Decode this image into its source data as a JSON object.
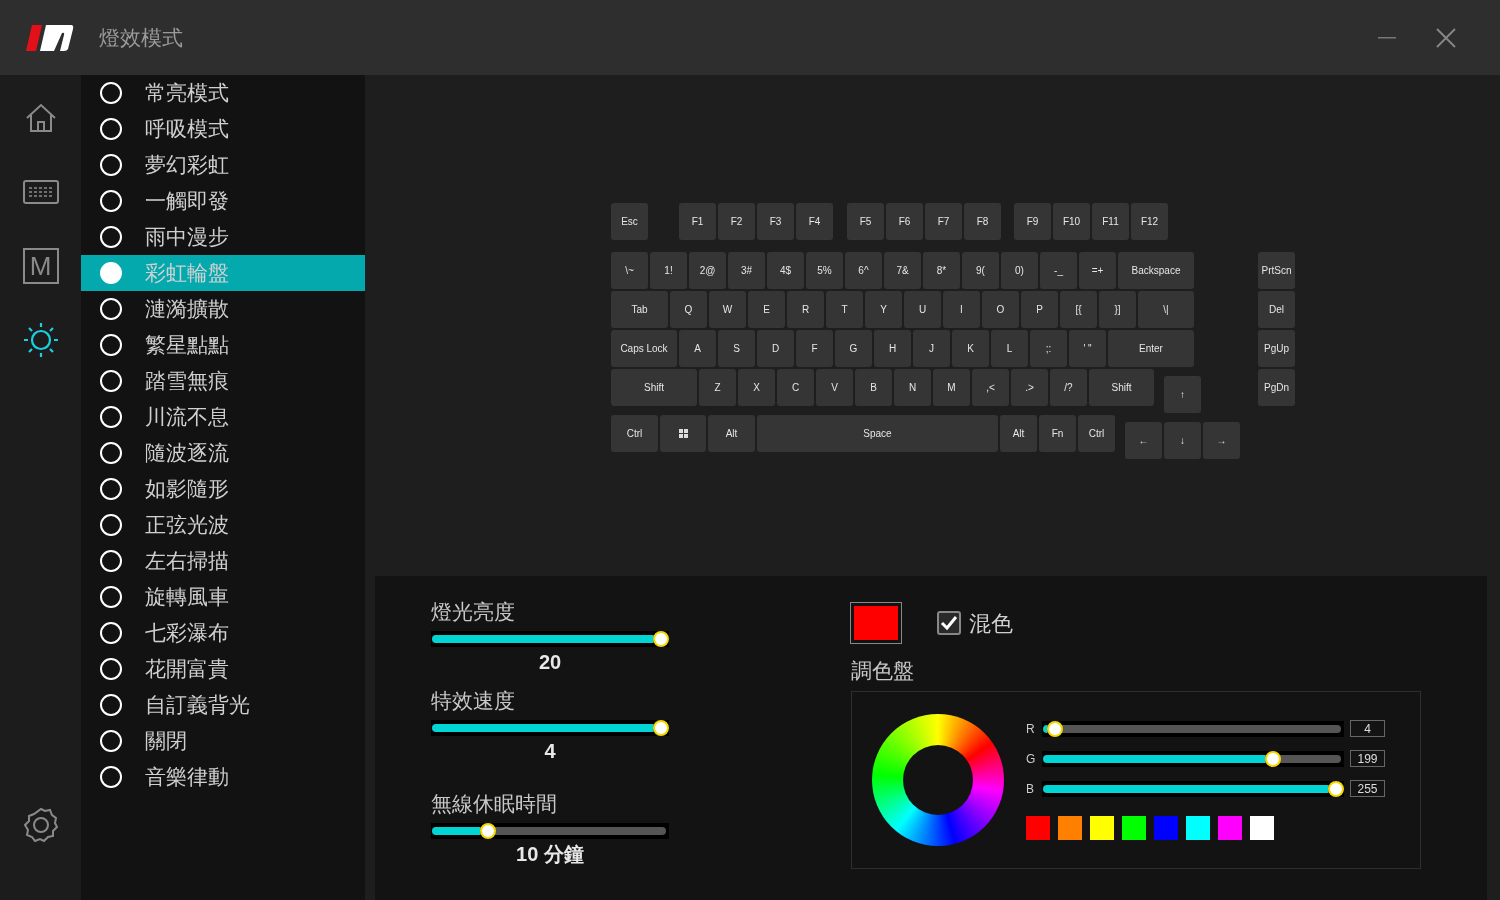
{
  "window": {
    "title": "燈效模式"
  },
  "nav": [
    {
      "kind": "home",
      "selected": false
    },
    {
      "kind": "keyboard",
      "selected": false
    },
    {
      "kind": "macro",
      "label": "M",
      "selected": false
    },
    {
      "kind": "lighting",
      "selected": true
    }
  ],
  "modes": [
    {
      "label": "常亮模式",
      "selected": false
    },
    {
      "label": "呼吸模式",
      "selected": false
    },
    {
      "label": "夢幻彩虹",
      "selected": false
    },
    {
      "label": "一觸即發",
      "selected": false
    },
    {
      "label": "雨中漫步",
      "selected": false
    },
    {
      "label": "彩虹輪盤",
      "selected": true
    },
    {
      "label": "漣漪擴散",
      "selected": false
    },
    {
      "label": "繁星點點",
      "selected": false
    },
    {
      "label": "踏雪無痕",
      "selected": false
    },
    {
      "label": "川流不息",
      "selected": false
    },
    {
      "label": "隨波逐流",
      "selected": false
    },
    {
      "label": "如影隨形",
      "selected": false
    },
    {
      "label": "正弦光波",
      "selected": false
    },
    {
      "label": "左右掃描",
      "selected": false
    },
    {
      "label": "旋轉風車",
      "selected": false
    },
    {
      "label": "七彩瀑布",
      "selected": false
    },
    {
      "label": "花開富貴",
      "selected": false
    },
    {
      "label": "自訂義背光",
      "selected": false
    },
    {
      "label": "關閉",
      "selected": false
    },
    {
      "label": "音樂律動",
      "selected": false
    }
  ],
  "keyboard": {
    "rows": [
      [
        "Esc",
        "F1",
        "F2",
        "F3",
        "F4",
        "F5",
        "F6",
        "F7",
        "F8",
        "F9",
        "F10",
        "F11",
        "F12"
      ],
      [
        "\\~",
        "1!",
        "2@",
        "3#",
        "4$",
        "5%",
        "6^",
        "7&",
        "8*",
        "9(",
        "0)",
        "-_",
        "=+",
        "Backspace"
      ],
      [
        "Tab",
        "Q",
        "W",
        "E",
        "R",
        "T",
        "Y",
        "U",
        "I",
        "O",
        "P",
        "[{",
        "}]",
        "\\|"
      ],
      [
        "Caps Lock",
        "A",
        "S",
        "D",
        "F",
        "G",
        "H",
        "J",
        "K",
        "L",
        ";:",
        "' \"",
        "Enter"
      ],
      [
        "Shift",
        "Z",
        "X",
        "C",
        "V",
        "B",
        "N",
        "M",
        ",<",
        ".>",
        "/?",
        "Shift",
        "↑"
      ],
      [
        "Ctrl",
        "",
        "Alt",
        "Space",
        "Alt",
        "Fn",
        "Ctrl",
        "←",
        "↓",
        "→"
      ]
    ],
    "nav_keys": [
      "PrtScn",
      "Del",
      "PgUp",
      "PgDn"
    ]
  },
  "sliders": [
    {
      "label": "燈光亮度",
      "level": 1,
      "reading": "20"
    },
    {
      "label": "特效速度",
      "level": 1,
      "reading": "4"
    },
    {
      "label": "無線休眠時間",
      "level": 0.22,
      "reading": "10 分鐘"
    }
  ],
  "current_color": {
    "color": "#ff0000"
  },
  "mix": {
    "label": "混色",
    "checked": true
  },
  "palette": {
    "title": "調色盤",
    "channels": [
      {
        "name": "R",
        "level": 0.016,
        "value": "4"
      },
      {
        "name": "G",
        "level": 0.78,
        "value": "199"
      },
      {
        "name": "B",
        "level": 1,
        "value": "255"
      }
    ],
    "swatches": [
      {
        "color": "#ff0000"
      },
      {
        "color": "#ff8000"
      },
      {
        "color": "#ffff00"
      },
      {
        "color": "#00ff00"
      },
      {
        "color": "#0000ff"
      },
      {
        "color": "#00ffff"
      },
      {
        "color": "#ff00ff"
      },
      {
        "color": "#ffffff"
      }
    ]
  }
}
